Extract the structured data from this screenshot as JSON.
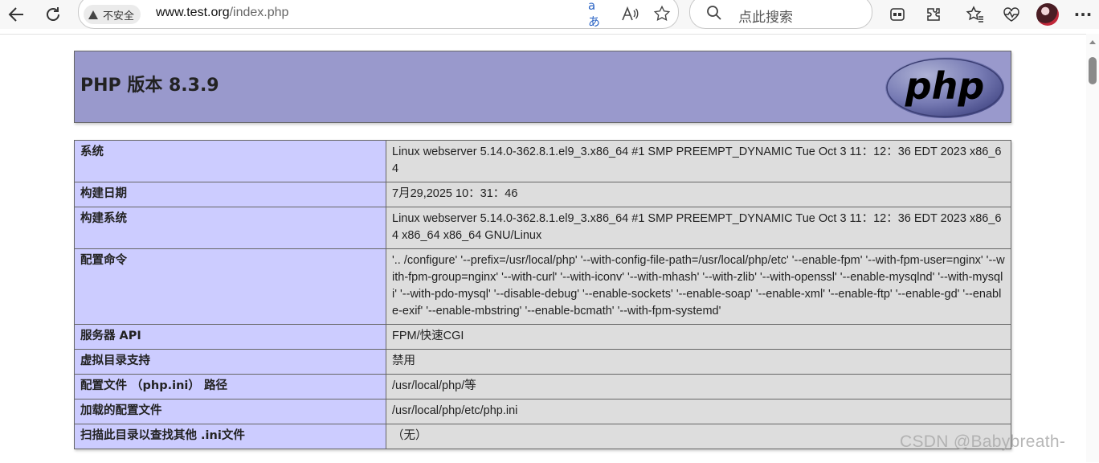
{
  "browser": {
    "security_label": "不安全",
    "url_host": "www.test.org",
    "url_path": "/index.php",
    "search_placeholder": "点此搜索",
    "icons": [
      "back-arrow-icon",
      "reload-icon",
      "translate-icon",
      "read-aloud-icon",
      "favorite-star-icon",
      "search-icon",
      "collections-icon",
      "extensions-icon",
      "favorites-icon",
      "performance-icon",
      "profile-avatar",
      "more-menu-icon"
    ]
  },
  "phpinfo": {
    "title": "PHP 版本 8.3.9",
    "logo_text": "php",
    "rows": [
      {
        "key": "系统",
        "value": "Linux webserver 5.14.0-362.8.1.el9_3.x86_64 #1 SMP PREEMPT_DYNAMIC Tue Oct 3 11：12：36 EDT 2023 x86_64"
      },
      {
        "key": "构建日期",
        "value": "7月29,2025 10：31：46"
      },
      {
        "key": "构建系统",
        "value": "Linux webserver 5.14.0-362.8.1.el9_3.x86_64 #1 SMP PREEMPT_DYNAMIC Tue Oct 3 11：12：36 EDT 2023 x86_64 x86_64 x86_64 GNU/Linux"
      },
      {
        "key": "配置命令",
        "value": "'.. /configure' '--prefix=/usr/local/php' '--with-config-file-path=/usr/local/php/etc' '--enable-fpm' '--with-fpm-user=nginx' '--with-fpm-group=nginx' '--with-curl' '--with-iconv' '--with-mhash' '--with-zlib' '--with-openssl' '--enable-mysqlnd' '--with-mysqli' '--with-pdo-mysql' '--disable-debug' '--enable-sockets' '--enable-soap' '--enable-xml' '--enable-ftp' '--enable-gd' '--enable-exif' '--enable-mbstring' '--enable-bcmath' '--with-fpm-systemd'"
      },
      {
        "key": "服务器 API",
        "value": "FPM/快速CGI"
      },
      {
        "key": "虚拟目录支持",
        "value": "禁用"
      },
      {
        "key": "配置文件 （php.ini） 路径",
        "value": "/usr/local/php/等"
      },
      {
        "key": "加载的配置文件",
        "value": "/usr/local/php/etc/php.ini"
      },
      {
        "key": "扫描此目录以查找其他 .ini文件",
        "value": "（无）"
      }
    ]
  },
  "watermark": "CSDN @Babybreath-",
  "colors": {
    "header_bg": "#9999cc",
    "key_bg": "#ccccff",
    "value_bg": "#dddddd"
  }
}
